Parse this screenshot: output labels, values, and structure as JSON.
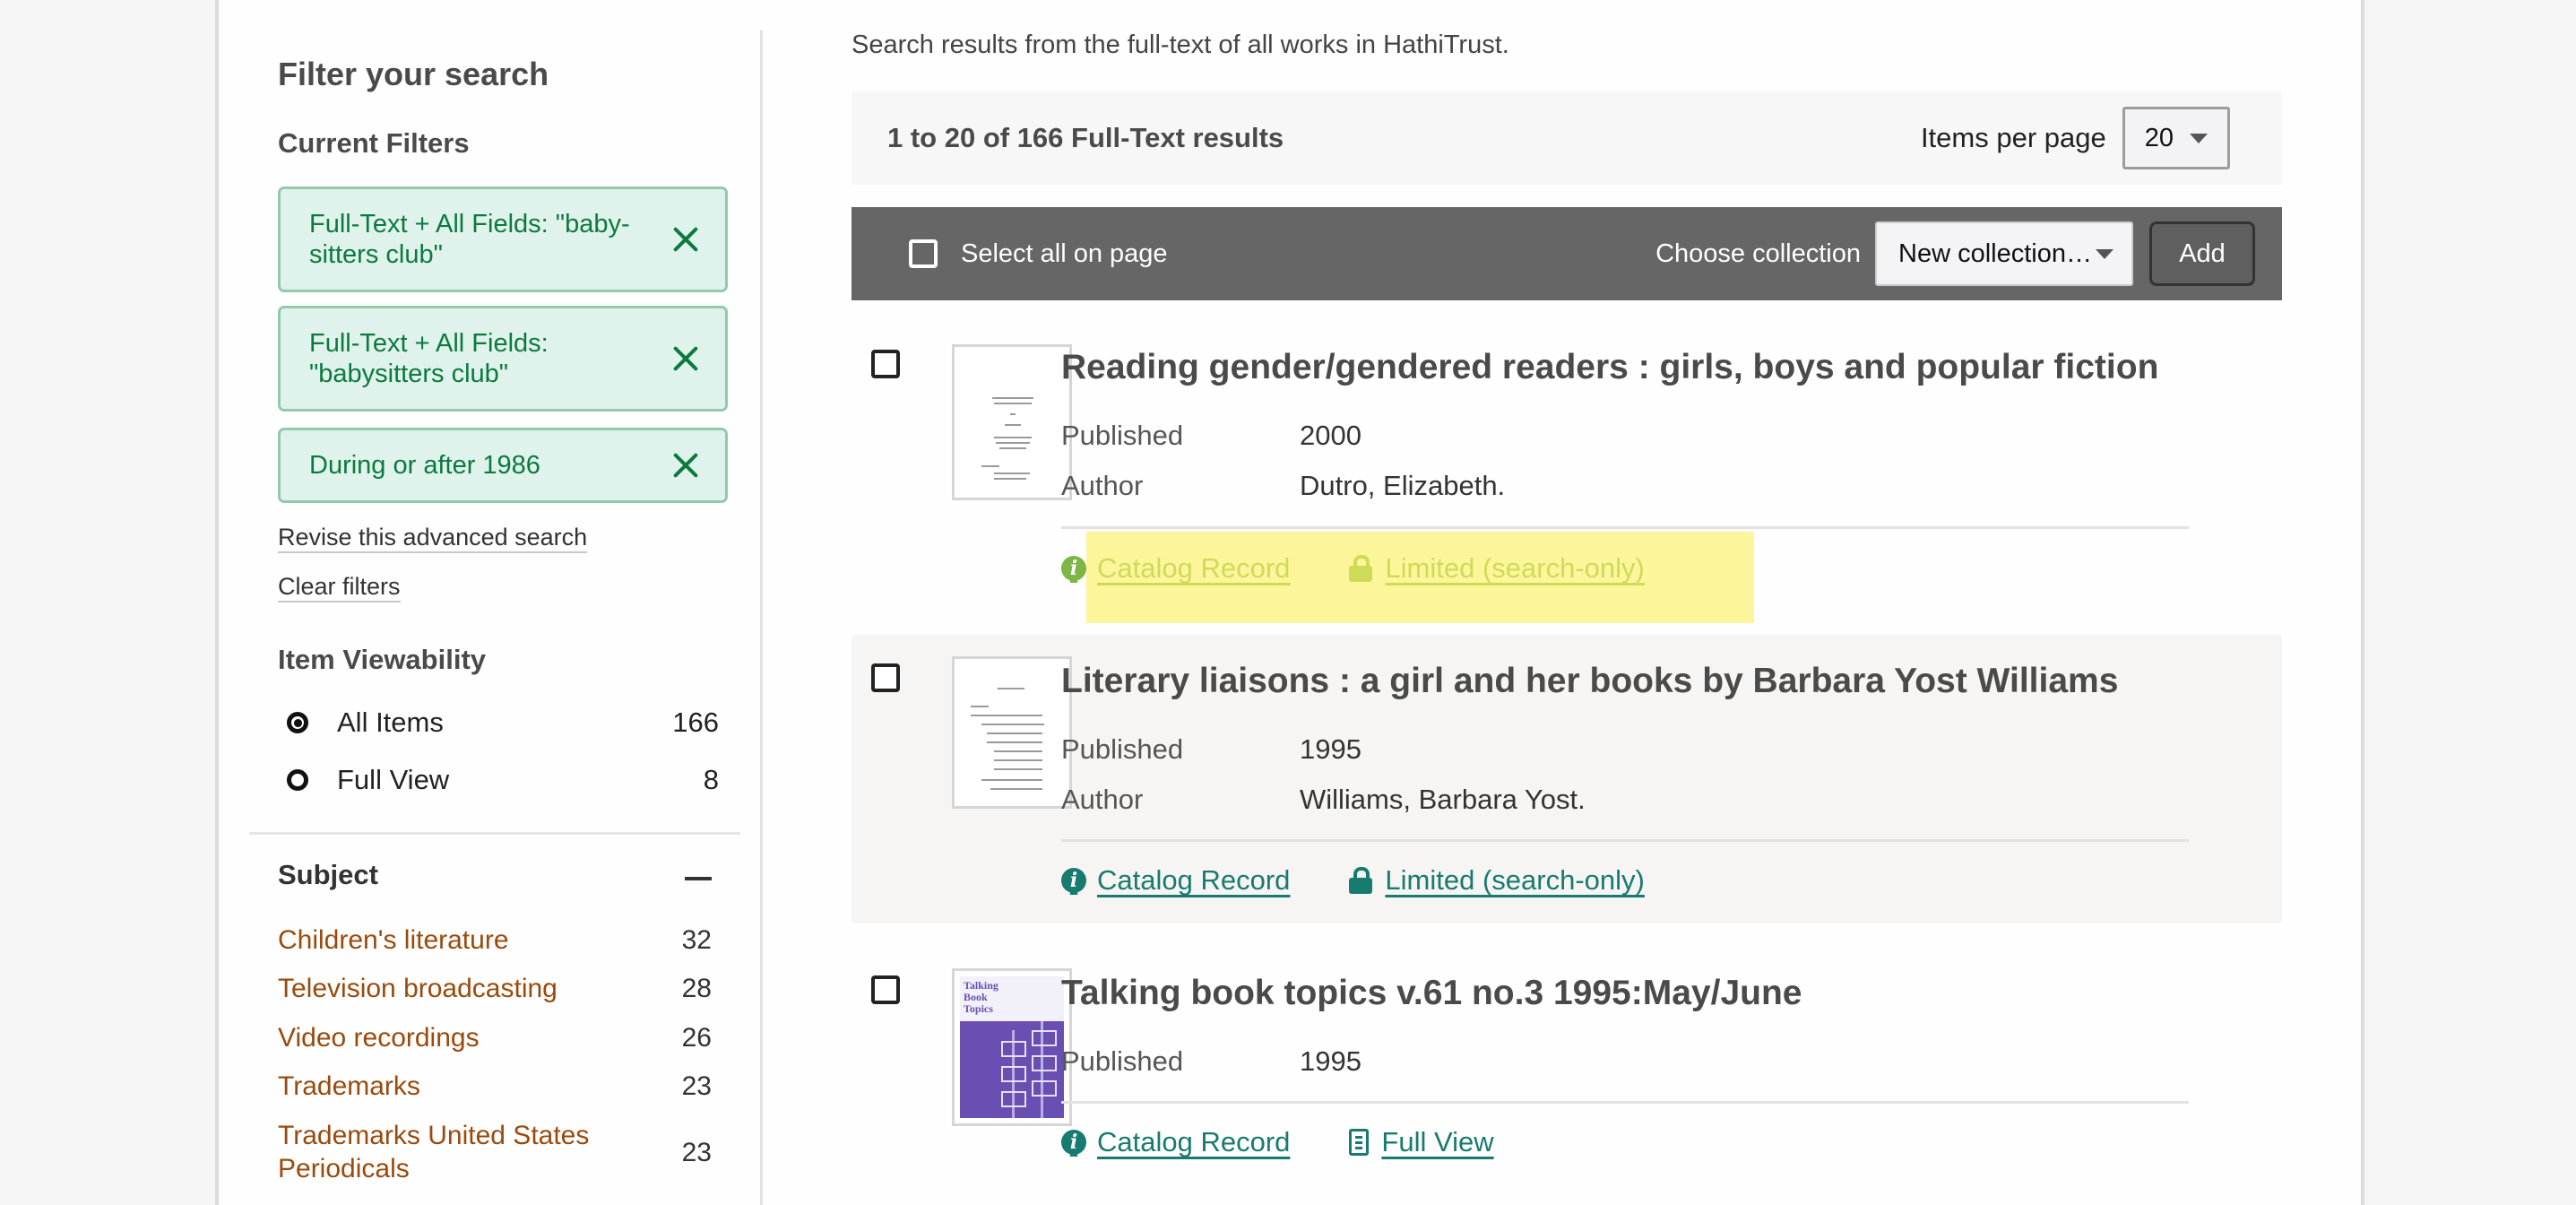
{
  "sidebar": {
    "title": "Filter your search",
    "current_filters_heading": "Current Filters",
    "filters": [
      {
        "label": "Full-Text + All Fields: \"baby-sitters club\""
      },
      {
        "label": "Full-Text + All Fields: \"babysitters club\""
      },
      {
        "label": "During or after 1986"
      }
    ],
    "revise_link": "Revise this advanced search",
    "clear_link": "Clear filters",
    "viewability": {
      "heading": "Item Viewability",
      "options": [
        {
          "label": "All Items",
          "count": "166",
          "checked": true
        },
        {
          "label": "Full View",
          "count": "8",
          "checked": false
        }
      ]
    },
    "subject": {
      "heading": "Subject",
      "items": [
        {
          "label": "Children's literature",
          "count": "32"
        },
        {
          "label": "Television broadcasting",
          "count": "28"
        },
        {
          "label": "Video recordings",
          "count": "26"
        },
        {
          "label": "Trademarks",
          "count": "23"
        },
        {
          "label": "Trademarks United States Periodicals",
          "count": "23"
        }
      ]
    }
  },
  "main": {
    "intro": "Search results from the full-text of all works in HathiTrust.",
    "results_count": "1 to 20 of 166 Full-Text results",
    "items_per_page_label": "Items per page",
    "items_per_page_value": "20",
    "toolbar": {
      "select_all_label": "Select all on page",
      "choose_collection_label": "Choose collection",
      "collection_value": "New collection…",
      "add_label": "Add"
    },
    "results": [
      {
        "title": "Reading gender/gendered readers : girls, boys and popular fiction",
        "published_label": "Published",
        "published": "2000",
        "author_label": "Author",
        "author": "Dutro, Elizabeth.",
        "catalog_label": "Catalog Record",
        "access_label": "Limited (search-only)",
        "access_icon": "lock-icon"
      },
      {
        "title": "Literary liaisons : a girl and her books by Barbara Yost Williams",
        "published_label": "Published",
        "published": "1995",
        "author_label": "Author",
        "author": "Williams, Barbara Yost.",
        "catalog_label": "Catalog Record",
        "access_label": "Limited (search-only)",
        "access_icon": "lock-icon"
      },
      {
        "title": "Talking book topics v.61 no.3 1995:May/June",
        "published_label": "Published",
        "published": "1995",
        "catalog_label": "Catalog Record",
        "access_label": "Full View",
        "access_icon": "document-icon"
      }
    ]
  },
  "colors": {
    "filter_green": "#0b7a3e",
    "filter_bg": "#e0f2ec",
    "link_teal": "#177b6f",
    "subject_link": "#9a4a0c",
    "toolbar_bg": "#666666",
    "highlight": "#faf064"
  }
}
